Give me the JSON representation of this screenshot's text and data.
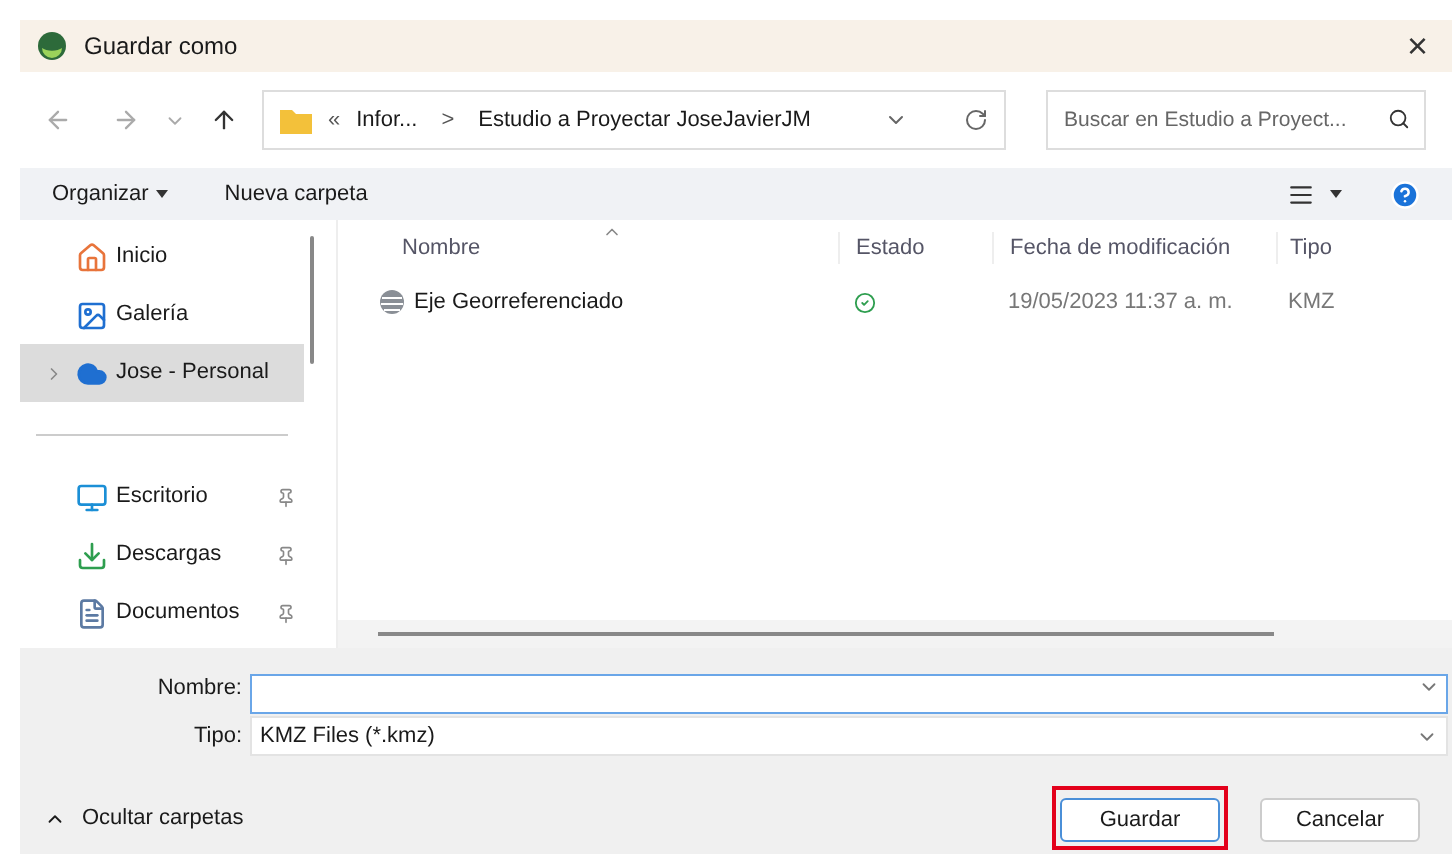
{
  "window": {
    "title": "Guardar como",
    "close": "×"
  },
  "address": {
    "overflow": "«",
    "crumbs": [
      "Infor...",
      "Estudio a Proyectar JoseJavierJM"
    ],
    "separator": ">"
  },
  "search": {
    "placeholder": "Buscar en Estudio a Proyect..."
  },
  "toolbar": {
    "organize": "Organizar",
    "new_folder": "Nueva carpeta"
  },
  "sidebar": {
    "items": [
      {
        "label": "Inicio",
        "kind": "home",
        "selected": false,
        "pinned": false,
        "expandable": false
      },
      {
        "label": "Galería",
        "kind": "gallery",
        "selected": false,
        "pinned": false,
        "expandable": false
      },
      {
        "label": "Jose - Personal",
        "kind": "cloud",
        "selected": true,
        "pinned": false,
        "expandable": true
      }
    ],
    "quick_access": [
      {
        "label": "Escritorio",
        "kind": "desktop",
        "selected": false,
        "pinned": true,
        "expandable": false
      },
      {
        "label": "Descargas",
        "kind": "download",
        "selected": false,
        "pinned": true,
        "expandable": false
      },
      {
        "label": "Documentos",
        "kind": "document",
        "selected": false,
        "pinned": true,
        "expandable": false
      }
    ]
  },
  "table": {
    "columns": [
      "Nombre",
      "Estado",
      "Fecha de modificación",
      "Tipo"
    ],
    "rows": [
      {
        "name": "Eje Georreferenciado",
        "synced": true,
        "modified": "19/05/2023 11:37 a. m.",
        "type": "KMZ"
      }
    ]
  },
  "form": {
    "name_label": "Nombre:",
    "type_label": "Tipo:",
    "type_value": "KMZ Files (*.kmz)"
  },
  "footer": {
    "toggle": "Ocultar carpetas",
    "buttons": [
      {
        "label": "Guardar",
        "highlighted": true,
        "default": true
      },
      {
        "label": "Cancelar",
        "highlighted": false,
        "default": false
      }
    ]
  }
}
